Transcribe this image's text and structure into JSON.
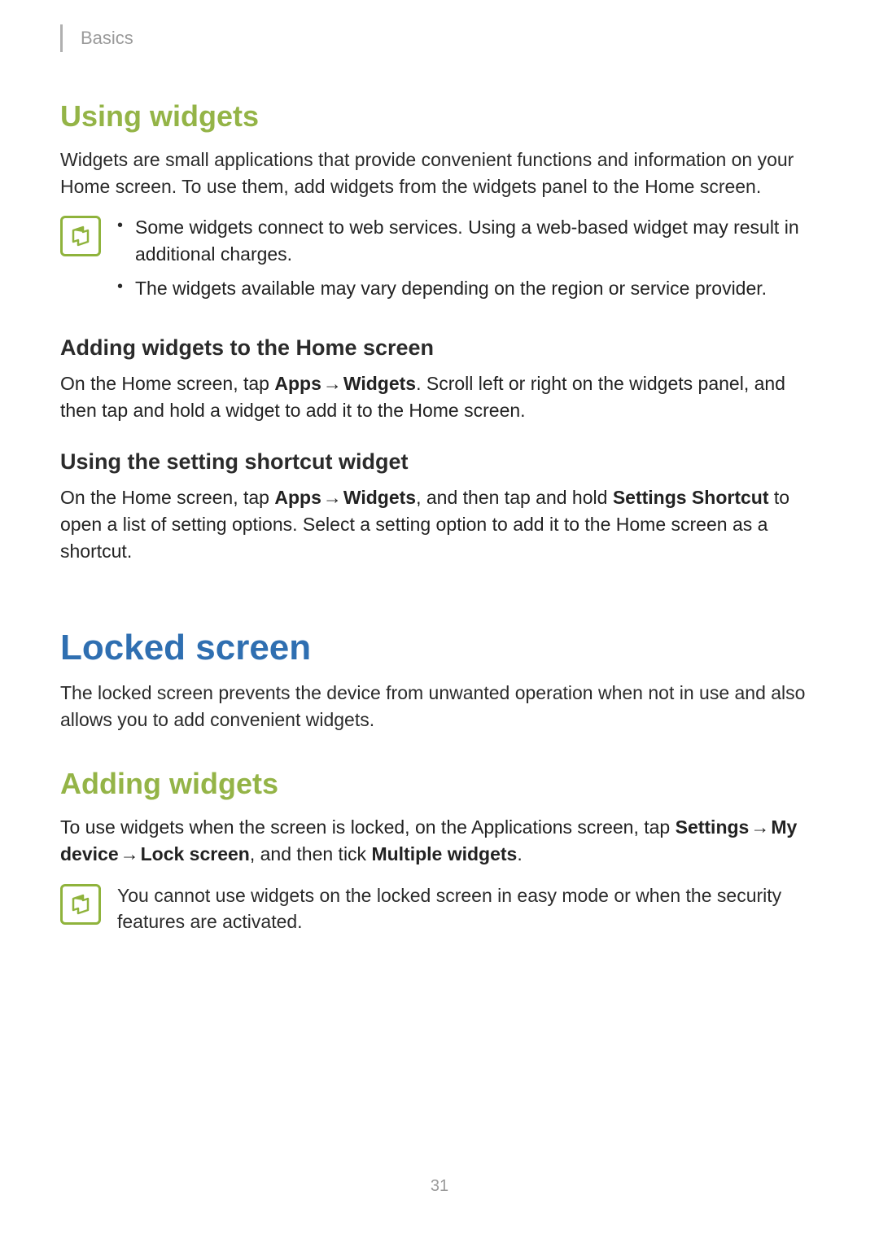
{
  "header": {
    "section": "Basics"
  },
  "sec1": {
    "title": "Using widgets",
    "intro": "Widgets are small applications that provide convenient functions and information on your Home screen. To use them, add widgets from the widgets panel to the Home screen.",
    "notes": [
      "Some widgets connect to web services. Using a web-based widget may result in additional charges.",
      "The widgets available may vary depending on the region or service provider."
    ],
    "sub1": {
      "title": "Adding widgets to the Home screen",
      "t1": "On the Home screen, tap ",
      "b1": "Apps",
      "arrow": " → ",
      "b2": "Widgets",
      "t2": ". Scroll left or right on the widgets panel, and then tap and hold a widget to add it to the Home screen."
    },
    "sub2": {
      "title": "Using the setting shortcut widget",
      "t1": "On the Home screen, tap ",
      "b1": "Apps",
      "arrow": " → ",
      "b2": "Widgets",
      "t2": ", and then tap and hold ",
      "b3": "Settings Shortcut",
      "t3": " to open a list of setting options. Select a setting option to add it to the Home screen as a shortcut."
    }
  },
  "sec2": {
    "title": "Locked screen",
    "intro": "The locked screen prevents the device from unwanted operation when not in use and also allows you to add convenient widgets."
  },
  "sec3": {
    "title": "Adding widgets",
    "para": {
      "t1": "To use widgets when the screen is locked, on the Applications screen, tap ",
      "b1": "Settings",
      "arrow": " → ",
      "b2": "My device",
      "b3": "Lock screen",
      "t2": ", and then tick ",
      "b4": "Multiple widgets",
      "t3": "."
    },
    "note": "You cannot use widgets on the locked screen in easy mode or when the security features are activated."
  },
  "pageNumber": "31"
}
